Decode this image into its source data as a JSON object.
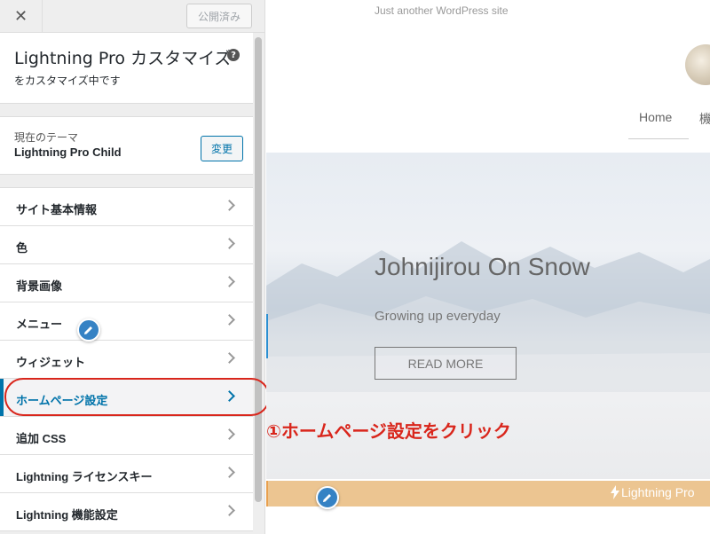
{
  "topbar": {
    "close_glyph": "✕",
    "publish_label": "公開済み"
  },
  "info": {
    "theme_short": "Lightning Pro",
    "title_suffix": "カスタマイズ",
    "help_glyph": "?",
    "subtitle": "をカスタマイズ中です"
  },
  "theme": {
    "label": "現在のテーマ",
    "name": "Lightning Pro Child",
    "change_label": "変更"
  },
  "menu": {
    "items": [
      {
        "label": "サイト基本情報",
        "active": false
      },
      {
        "label": "色",
        "active": false
      },
      {
        "label": "背景画像",
        "active": false
      },
      {
        "label": "メニュー",
        "active": false
      },
      {
        "label": "ウィジェット",
        "active": false
      },
      {
        "label": "ホームページ設定",
        "active": true
      },
      {
        "label": "追加 CSS",
        "active": false
      },
      {
        "label": "Lightning ライセンスキー",
        "active": false
      },
      {
        "label": "Lightning 機能設定",
        "active": false
      }
    ]
  },
  "preview": {
    "tagline": "Just another WordPress site",
    "nav_home": "Home",
    "nav_next": "機",
    "hero_title": "Johnijirou On Snow",
    "hero_sub": "Growing up everyday",
    "hero_button": "READ MORE",
    "promo": "Lightning Pro"
  },
  "annotation": "①ホームページ設定をクリック",
  "colors": {
    "accent": "#0073aa",
    "annotation": "#d9261c",
    "promo_bar": "#ecc591",
    "pencil": "#3582c4"
  }
}
